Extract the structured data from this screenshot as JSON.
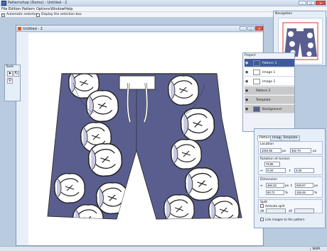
{
  "app": {
    "title": "Patternshop (Demo) - Untitled - 2"
  },
  "menu": [
    "File",
    "Edition",
    "Pattern",
    "Options",
    "Window",
    "Help"
  ],
  "options": {
    "automatic_selection": {
      "label": "Automatic selection",
      "checked": true
    },
    "display_selection_box": {
      "label": "Display the selection box",
      "checked": false
    }
  },
  "document": {
    "title": "Untitled - 2"
  },
  "tools": {
    "title": "Tools",
    "items": [
      "pointer-tool-icon",
      "rotate-tool-icon",
      "zoom-tool-icon"
    ]
  },
  "navigation": {
    "title": "Navigation"
  },
  "project": {
    "title": "Project",
    "layers": [
      {
        "label": "Pattern 1",
        "selected": true
      },
      {
        "label": "Image 1"
      },
      {
        "label": "Image 1"
      },
      {
        "label": "Pattern 2"
      },
      {
        "label": "Template"
      },
      {
        "label": "Background"
      }
    ]
  },
  "properties": {
    "tabs": [
      "Pattern",
      "Image",
      "Template"
    ],
    "location": {
      "label": "Location",
      "x": "1004.50",
      "y": "362.70",
      "unit": "px"
    },
    "rotation": {
      "label": "Rotation et torsion",
      "angle": "78.95",
      "h": "0.00",
      "v": "0.00"
    },
    "dimension": {
      "label": "Dimension",
      "w": "484.33",
      "w_unit": "px",
      "h": "920.67",
      "h_unit": "px",
      "w_pct": "80.72",
      "h_pct": "153.45",
      "pct_unit": "%"
    },
    "split": {
      "label": "Split",
      "activate": "Activate split",
      "dx_label": "dX",
      "dy_label": "dY",
      "dx": "",
      "dy": ""
    },
    "link": {
      "label": "Link images to the pattern"
    }
  },
  "status": {
    "num": "NUM"
  },
  "colors": {
    "fabric": "#5a5e8f",
    "accent": "#3e5a9a"
  }
}
